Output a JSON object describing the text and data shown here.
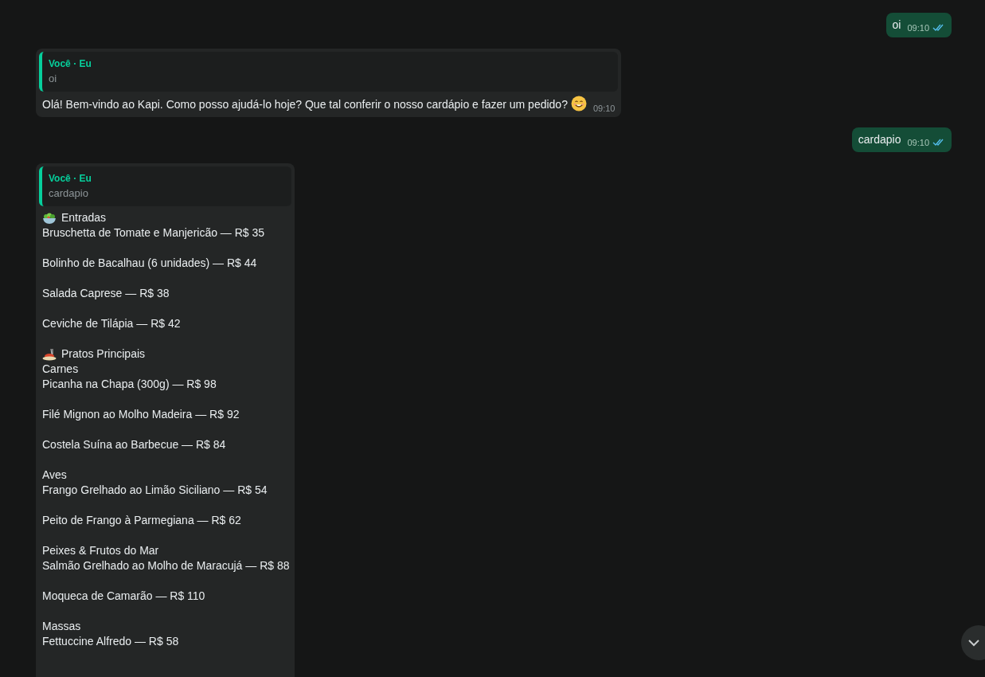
{
  "messages": [
    {
      "kind": "outgoing",
      "text": "oi",
      "time": "09:10",
      "read": true
    },
    {
      "kind": "incoming",
      "quote": {
        "author": "Você · Eu",
        "text": "oi"
      },
      "text": "Olá! Bem-vindo ao Kapi. Como posso ajudá-lo hoje? Que tal conferir o nosso cardápio e fazer um pedido?",
      "emoji": true,
      "time": "09:10"
    },
    {
      "kind": "outgoing",
      "text": "cardapio",
      "time": "09:10",
      "read": true
    },
    {
      "kind": "menu",
      "quote": {
        "author": "Você · Eu",
        "text": "cardapio"
      },
      "paragraphs": [
        [
          {
            "kind": "heading",
            "text": "Entradas"
          },
          {
            "kind": "text",
            "text": "Bruschetta de Tomate e Manjericão — R$ 35"
          }
        ],
        [
          {
            "kind": "text",
            "text": "Bolinho de Bacalhau (6 unidades) — R$ 44"
          }
        ],
        [
          {
            "kind": "text",
            "text": "Salada Caprese — R$ 38"
          }
        ],
        [
          {
            "kind": "text",
            "text": "Ceviche de Tilápia — R$ 42"
          }
        ],
        [
          {
            "kind": "heading",
            "text": "Pratos Principais"
          },
          {
            "kind": "text",
            "text": "Carnes"
          },
          {
            "kind": "text",
            "text": "Picanha na Chapa (300g) — R$ 98"
          }
        ],
        [
          {
            "kind": "text",
            "text": "Filé Mignon ao Molho Madeira — R$ 92"
          }
        ],
        [
          {
            "kind": "text",
            "text": "Costela Suína ao Barbecue — R$ 84"
          }
        ],
        [
          {
            "kind": "text",
            "text": "Aves"
          },
          {
            "kind": "text",
            "text": "Frango Grelhado ao Limão Siciliano — R$ 54"
          }
        ],
        [
          {
            "kind": "text",
            "text": "Peito de Frango à Parmegiana — R$ 62"
          }
        ],
        [
          {
            "kind": "text",
            "text": "Peixes & Frutos do Mar"
          },
          {
            "kind": "text",
            "text": "Salmão Grelhado ao Molho de Maracujá — R$ 88"
          }
        ],
        [
          {
            "kind": "text",
            "text": "Moqueca de Camarão — R$ 110"
          }
        ],
        [
          {
            "kind": "text",
            "text": "Massas"
          },
          {
            "kind": "text",
            "text": "Fettuccine Alfredo — R$ 58"
          }
        ]
      ]
    }
  ]
}
